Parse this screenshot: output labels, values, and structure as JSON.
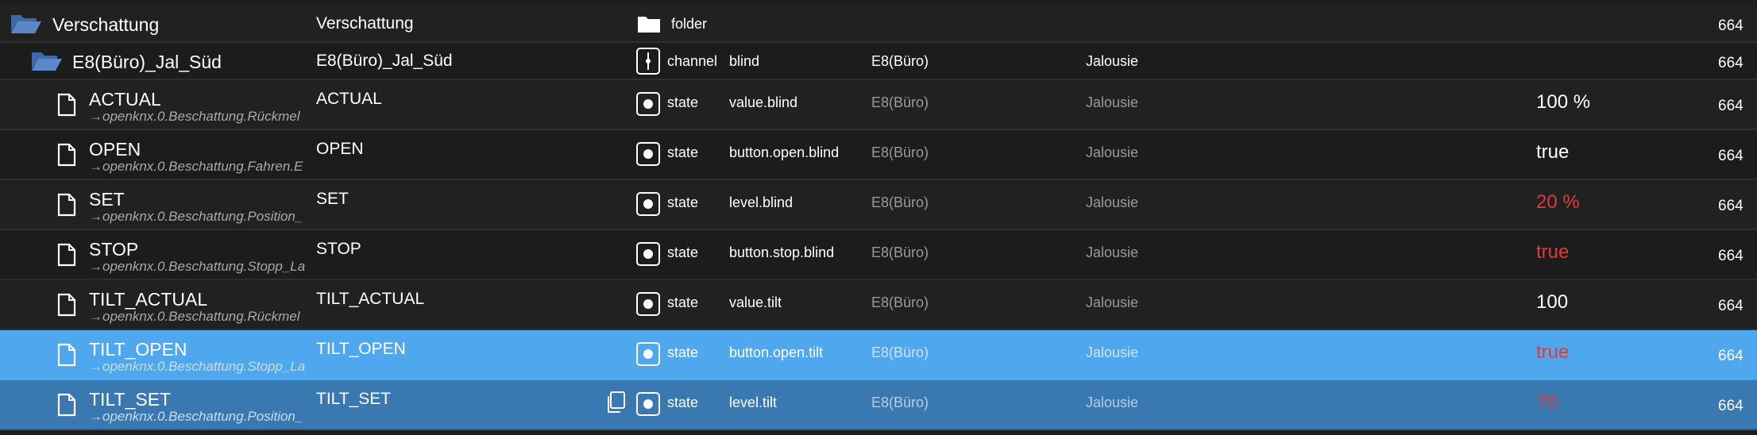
{
  "rows": [
    {
      "name": "Verschattung",
      "alias": "",
      "col2": "Verschattung",
      "type": "folder",
      "role": "",
      "room": "",
      "func": "",
      "value": "",
      "perm": "664",
      "kind": "folder"
    },
    {
      "name": "E8(Büro)_Jal_Süd",
      "alias": "",
      "col2": "E8(Büro)_Jal_Süd",
      "type": "channel",
      "role": "blind",
      "room": "E8(Büro)",
      "func": "Jalousie",
      "value": "",
      "perm": "664",
      "kind": "channel"
    },
    {
      "name": "ACTUAL",
      "alias": "→openknx.0.Beschattung.Rückmel",
      "col2": "ACTUAL",
      "type": "state",
      "role": "value.blind",
      "room": "E8(Büro)",
      "func": "Jalousie",
      "value": "100 %",
      "perm": "664",
      "kind": "state"
    },
    {
      "name": "OPEN",
      "alias": "→openknx.0.Beschattung.Fahren.E",
      "col2": "OPEN",
      "type": "state",
      "role": "button.open.blind",
      "room": "E8(Büro)",
      "func": "Jalousie",
      "value": "true",
      "perm": "664",
      "kind": "state"
    },
    {
      "name": "SET",
      "alias": "→openknx.0.Beschattung.Position_",
      "col2": "SET",
      "type": "state",
      "role": "level.blind",
      "room": "E8(Büro)",
      "func": "Jalousie",
      "value": "20 %",
      "perm": "664",
      "kind": "state"
    },
    {
      "name": "STOP",
      "alias": "→openknx.0.Beschattung.Stopp_La",
      "col2": "STOP",
      "type": "state",
      "role": "button.stop.blind",
      "room": "E8(Büro)",
      "func": "Jalousie",
      "value": "true",
      "perm": "664",
      "kind": "state"
    },
    {
      "name": "TILT_ACTUAL",
      "alias": "→openknx.0.Beschattung.Rückmel",
      "col2": "TILT_ACTUAL",
      "type": "state",
      "role": "value.tilt",
      "room": "E8(Büro)",
      "func": "Jalousie",
      "value": "100",
      "perm": "664",
      "kind": "state"
    },
    {
      "name": "TILT_OPEN",
      "alias": "→openknx.0.Beschattung.Stopp_La",
      "col2": "TILT_OPEN",
      "type": "state",
      "role": "button.open.tilt",
      "room": "E8(Büro)",
      "func": "Jalousie",
      "value": "true",
      "perm": "664",
      "kind": "state"
    },
    {
      "name": "TILT_SET",
      "alias": "→openknx.0.Beschattung.Position_",
      "col2": "TILT_SET",
      "type": "state",
      "role": "level.tilt",
      "room": "E8(Büro)",
      "func": "Jalousie",
      "value": "70",
      "perm": "664",
      "kind": "state"
    }
  ],
  "colors": {
    "value_white": "#ffffff",
    "value_red": "#e03a3a",
    "folder_icon": "#5b87c9",
    "selected_light": "#4fa8ee",
    "selected_dark": "#3a78b2"
  },
  "icons": {
    "folder_open": "folder-open-icon",
    "folder_closed": "folder-icon",
    "file": "file-icon",
    "state": "state-icon",
    "channel": "channel-icon",
    "copy": "copy-icon"
  }
}
